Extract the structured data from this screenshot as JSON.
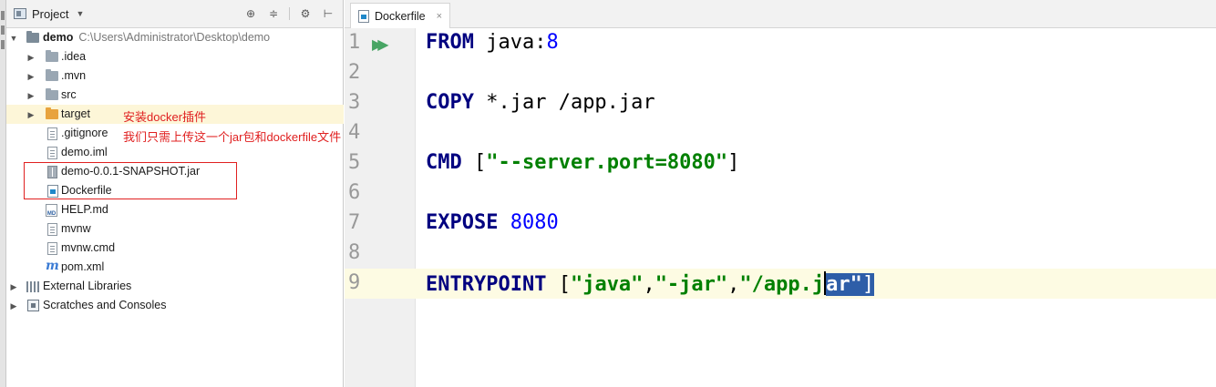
{
  "project_panel": {
    "title": "Project",
    "dropdown_glyph": "▼",
    "header_icons": [
      "target-icon",
      "collapse-icon",
      "gear-icon",
      "hide-icon"
    ],
    "tree": [
      {
        "name": "demo",
        "path": "C:\\Users\\Administrator\\Desktop\\demo",
        "type": "root-folder",
        "expanded": true
      },
      {
        "name": ".idea",
        "type": "folder",
        "expanded": false
      },
      {
        "name": ".mvn",
        "type": "folder",
        "expanded": false
      },
      {
        "name": "src",
        "type": "folder",
        "expanded": false
      },
      {
        "name": "target",
        "type": "folder-excluded",
        "expanded": false,
        "selected": true
      },
      {
        "name": ".gitignore",
        "type": "file"
      },
      {
        "name": "demo.iml",
        "type": "file"
      },
      {
        "name": "demo-0.0.1-SNAPSHOT.jar",
        "type": "jar"
      },
      {
        "name": "Dockerfile",
        "type": "dockerfile"
      },
      {
        "name": "HELP.md",
        "type": "markdown"
      },
      {
        "name": "mvnw",
        "type": "file"
      },
      {
        "name": "mvnw.cmd",
        "type": "file"
      },
      {
        "name": "pom.xml",
        "type": "maven"
      },
      {
        "name": "External Libraries",
        "type": "libraries",
        "expanded": false
      },
      {
        "name": "Scratches and Consoles",
        "type": "scratches",
        "expanded": false
      }
    ]
  },
  "annotations": {
    "line1": "安装docker插件",
    "line2": "我们只需上传这一个jar包和dockerfile文件",
    "color": "#e02020"
  },
  "editor": {
    "tab_label": "Dockerfile",
    "tab_close": "×",
    "caret_line": 9,
    "lines": [
      {
        "n": "1",
        "kw": "FROM",
        "rest_plain": " java:",
        "rest_num": "8"
      },
      {
        "n": "2"
      },
      {
        "n": "3",
        "kw": "COPY",
        "rest_plain": " *.jar /app.jar"
      },
      {
        "n": "4"
      },
      {
        "n": "5",
        "kw": "CMD",
        "rest_plain": " [",
        "str": "\"--server.port=8080\"",
        "end": "]"
      },
      {
        "n": "6"
      },
      {
        "n": "7",
        "kw": "EXPOSE",
        "rest_num": " 8080"
      },
      {
        "n": "8"
      },
      {
        "n": "9",
        "kw": "ENTRYPOINT",
        "rest_plain": " [",
        "s1": "\"java\"",
        "c1": ",",
        "s2": "\"-jar\"",
        "c2": ",",
        "s3a": "\"/app.j",
        "s3b": "ar\"",
        "end": "]"
      }
    ]
  },
  "colors": {
    "keyword": "#000080",
    "number": "#0000ff",
    "string": "#008000",
    "selection": "#2e5ea8",
    "caret_line": "#fdfbe3"
  }
}
